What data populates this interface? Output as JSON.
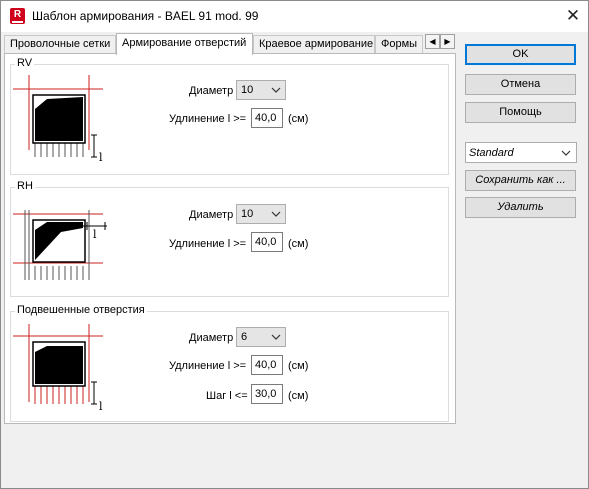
{
  "window": {
    "title": "Шаблон армирования - BAEL 91 mod. 99",
    "app_icon": "R"
  },
  "tabs": [
    {
      "label": "Проволочные сетки",
      "active": false
    },
    {
      "label": "Армирование отверстий",
      "active": true
    },
    {
      "label": "Краевое армирование",
      "active": false
    },
    {
      "label": "Формы",
      "active": false
    }
  ],
  "tab_scroll": {
    "left": "◀",
    "right": "▶"
  },
  "groups": {
    "rv": {
      "title": "RV",
      "diameter_label": "Диаметр",
      "diameter_value": "10",
      "ext_label": "Удлинение l >=",
      "ext_value": "40,0",
      "ext_unit": "(см)",
      "dim_label": "l"
    },
    "rh": {
      "title": "RH",
      "diameter_label": "Диаметр",
      "diameter_value": "10",
      "ext_label": "Удлинение l >=",
      "ext_value": "40,0",
      "ext_unit": "(см)",
      "dim_label": "l"
    },
    "hanging": {
      "title": "Подвешенные отверстия",
      "diameter_label": "Диаметр",
      "diameter_value": "6",
      "ext_label": "Удлинение l >=",
      "ext_value": "40,0",
      "ext_unit": "(см)",
      "step_label": "Шаг l <=",
      "step_value": "30,0",
      "step_unit": "(см)",
      "dim_label": "l"
    }
  },
  "buttons": {
    "ok": "OK",
    "cancel": "Отмена",
    "help": "Помощь",
    "save_as": "Сохранить как ...",
    "delete": "Удалить"
  },
  "standard_select": {
    "value": "Standard"
  },
  "colors": {
    "rebar": "#cc1f1f",
    "focus": "#0078d7"
  }
}
